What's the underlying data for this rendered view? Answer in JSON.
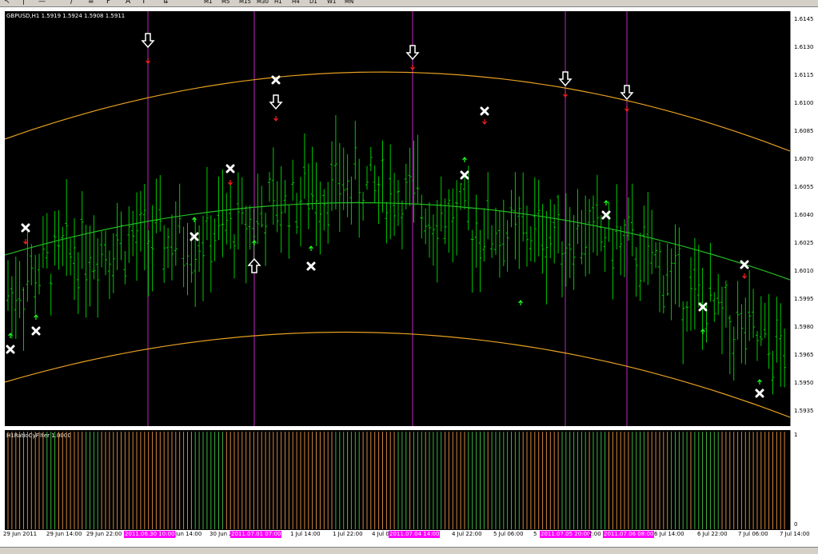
{
  "symbol_header": "GBPUSD,H1  1.5919 1.5924 1.5908 1.5911",
  "indicator_header": "H1RatioCyFilter 1.0000",
  "toolbar": {
    "icons": [
      "cursor-icon",
      "vline-icon",
      "hline-icon",
      "trendline-icon",
      "channel-icon",
      "fibo-icon",
      "text-icon",
      "label-icon",
      "arrows-icon"
    ],
    "timeframes": [
      "M1",
      "M5",
      "M15",
      "M30",
      "H1",
      "H4",
      "D1",
      "W1",
      "MN"
    ]
  },
  "price_axis": [
    "1.6145",
    "1.6130",
    "1.6115",
    "1.6100",
    "1.6085",
    "1.6070",
    "1.6055",
    "1.6040",
    "1.6025",
    "1.6010",
    "1.5995",
    "1.5980",
    "1.5965",
    "1.5950",
    "1.5935"
  ],
  "indicator_axis": {
    "top": "1",
    "bottom": "0"
  },
  "time_axis": [
    "29 Jun 2011",
    "29 Jun 14:00",
    "29 Jun 22:00",
    "2011.06.30 10:00",
    "Jun 14:00",
    "30 Jun 2",
    "2011.07.01 07:00",
    "1 Jul 14:00",
    "1 Jul 22:00",
    "4 Jul 0",
    "2011.07.04 14:00",
    "4 Jul 22:00",
    "5 Jul 06:00",
    "5",
    "2011.07.05 20:00",
    "2:00",
    "2011.07.06 08:00",
    "6 Jul 14:00",
    "6 Jul 22:00",
    "7 Jul 06:00",
    "7 Jul 14:00"
  ],
  "highlighted_times": [
    "2011.06.30 10:00",
    "2011.07.01 07:00",
    "2011.07.04 14:00",
    "2011.07.05 20:00",
    "2011.07.06 08:00"
  ],
  "colors": {
    "background": "#000000",
    "candle": "#00c800",
    "envelope": "#e6a020",
    "mid_band": "#22bb22",
    "vertical_markers": "#a020a0",
    "highlight_label": "#ff00ff",
    "down_arrow": "#ff2020",
    "up_arrow": "#20ff20",
    "ind_orange": "#d2863c",
    "ind_green": "#3cb43c"
  },
  "price_range": [
    1.593,
    1.615
  ]
}
